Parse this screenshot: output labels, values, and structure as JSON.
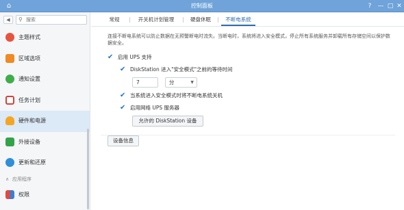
{
  "window": {
    "title": "控制面板",
    "help_glyph": "?",
    "minimize_glyph": "—",
    "maximize_glyph": "□",
    "close_glyph": "✕"
  },
  "sidebar": {
    "search_placeholder": "搜索",
    "items": [
      {
        "label": "主题样式",
        "icon": "theme-icon"
      },
      {
        "label": "区域选项",
        "icon": "region-icon"
      },
      {
        "label": "通知设置",
        "icon": "notification-icon"
      },
      {
        "label": "任务计划",
        "icon": "task-scheduler-icon"
      },
      {
        "label": "硬件和电源",
        "icon": "hardware-power-icon",
        "active": true
      },
      {
        "label": "外接设备",
        "icon": "external-device-icon"
      },
      {
        "label": "更新和还原",
        "icon": "update-restore-icon"
      }
    ],
    "group": {
      "label": "应用程序",
      "collapsed": false
    },
    "group_items": [
      {
        "label": "权限",
        "icon": "privileges-icon"
      }
    ]
  },
  "main": {
    "tabs": [
      {
        "label": "常规"
      },
      {
        "label": "开关机计划管理"
      },
      {
        "label": "硬盘休眠"
      },
      {
        "label": "不断电系统",
        "active": true
      }
    ],
    "description": "连接不断电系统可以防止数据在无预警断电时流失。当断电时，系统将进入安全模式，停止所有系统服务并卸载所有存储空间以保护数据安全。",
    "ups_enable_label": "启用 UPS 支持",
    "wait_time_label": "DiskStation 进入\"安全模式\"之前的等待时间",
    "wait_value": "7",
    "wait_unit": "分",
    "shutdown_label": "当系统进入安全模式时将不断电系统关机",
    "network_ups_label": "启用网络 UPS 服务器",
    "permitted_button": "允许的 DiskStation 设备",
    "device_info_button": "设备信息"
  },
  "colors": {
    "titlebar": "#6fa3d9",
    "accent": "#2b6cb0",
    "checkbox": "#1e73c9",
    "sidebar_active": "#dce9f6"
  }
}
